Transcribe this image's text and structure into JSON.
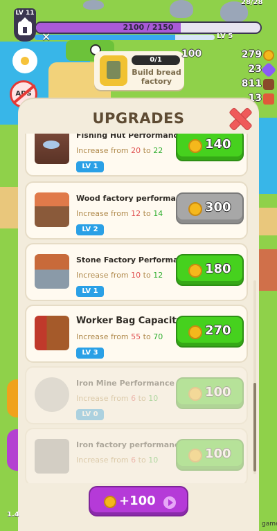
{
  "hud": {
    "player_level": "LV 11",
    "xp_text": "2100 / 2150",
    "xp_progress": 0.9767,
    "secondary_progress": 0.78,
    "next_level": "LV 5",
    "top_counter": "28/28"
  },
  "resources": [
    {
      "value": "279",
      "icon": "coin-icon",
      "color": "#f5b81c"
    },
    {
      "value": "23",
      "icon": "gem-icon",
      "color": "#8b5cf6"
    },
    {
      "value": "811",
      "icon": "wood-log-icon",
      "color": "#8a4a2a"
    },
    {
      "value": "13",
      "icon": "brick-icon",
      "color": "#e05a3a"
    }
  ],
  "resource_100": "100",
  "quest": {
    "progress": "0/1",
    "title": "Build bread factory"
  },
  "no_ads_label": "ADS",
  "panel": {
    "title": "UPGRADES",
    "items": [
      {
        "title": "Fishing Hut Performance",
        "prefix": "Increase from",
        "from": "20",
        "to_word": "to",
        "to": "22",
        "level": "LV 1",
        "price": "140",
        "state": "available"
      },
      {
        "title": "Wood factory performance",
        "prefix": "Increase from",
        "from": "12",
        "to_word": "to",
        "to": "14",
        "level": "LV 2",
        "price": "300",
        "state": "disabled"
      },
      {
        "title": "Stone Factory Performance",
        "prefix": "Increase from",
        "from": "10",
        "to_word": "to",
        "to": "12",
        "level": "LV 1",
        "price": "180",
        "state": "available"
      },
      {
        "title": "Worker Bag Capacity",
        "prefix": "Increase from",
        "from": "55",
        "to_word": "to",
        "to": "70",
        "level": "LV 3",
        "price": "270",
        "state": "available"
      },
      {
        "title": "Iron Mine Performance",
        "prefix": "Increase from",
        "from": "6",
        "to_word": "to",
        "to": "10",
        "level": "LV 0",
        "price": "100",
        "state": "locked"
      },
      {
        "title": "Iron factory performance",
        "prefix": "Increase from",
        "from": "6",
        "to_word": "to",
        "to": "10",
        "level": "",
        "price": "100",
        "state": "locked"
      }
    ]
  },
  "reward_button": {
    "label": "+100"
  },
  "bottom_left_text": "1.4",
  "watermark": "game"
}
